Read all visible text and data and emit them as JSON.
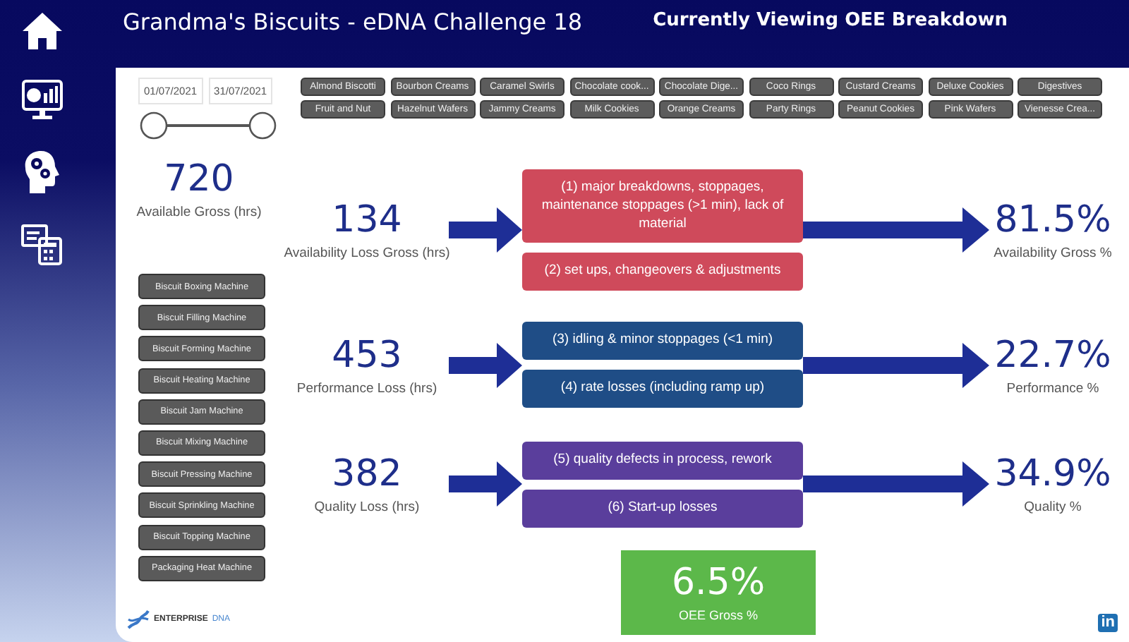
{
  "header": {
    "title": "Grandma's Biscuits - eDNA Challenge 18",
    "view_title": "Currently Viewing OEE Breakdown"
  },
  "date_range": {
    "start": "01/07/2021",
    "end": "31/07/2021",
    "handles": [
      {
        "level": 0
      },
      {
        "level": 1
      }
    ]
  },
  "product_chips": [
    {
      "label": "Almond Biscotti",
      "selected": false
    },
    {
      "label": "Bourbon Creams",
      "selected": false
    },
    {
      "label": "Caramel Swirls",
      "selected": false
    },
    {
      "label": "Chocolate cook...",
      "selected": false
    },
    {
      "label": "Chocolate Dige...",
      "selected": false
    },
    {
      "label": "Coco Rings",
      "selected": false
    },
    {
      "label": "Custard Creams",
      "selected": false
    },
    {
      "label": "Deluxe Cookies",
      "selected": false
    },
    {
      "label": "Digestives",
      "selected": false
    },
    {
      "label": "Fruit and Nut",
      "selected": false
    },
    {
      "label": "Hazelnut Wafers",
      "selected": false
    },
    {
      "label": "Jammy Creams",
      "selected": false
    },
    {
      "label": "Milk Cookies",
      "selected": false
    },
    {
      "label": "Orange Creams",
      "selected": false
    },
    {
      "label": "Party Rings",
      "selected": false
    },
    {
      "label": "Peanut Cookies",
      "selected": false
    },
    {
      "label": "Pink Wafers",
      "selected": false
    },
    {
      "label": "Vienesse Crea...",
      "selected": false
    }
  ],
  "available": {
    "value": "720",
    "label": "Available Gross (hrs)"
  },
  "machines": [
    {
      "label": "Biscuit Boxing Machine",
      "selected": false
    },
    {
      "label": "Biscuit Filling Machine",
      "selected": false
    },
    {
      "label": "Biscuit Forming Machine",
      "selected": false
    },
    {
      "label": "Biscuit Heating Machine",
      "selected": false
    },
    {
      "label": "Biscuit Jam Machine",
      "selected": false
    },
    {
      "label": "Biscuit Mixing Machine",
      "selected": false
    },
    {
      "label": "Biscuit Pressing Machine",
      "selected": false
    },
    {
      "label": "Biscuit Sprinkling Machine",
      "selected": false
    },
    {
      "label": "Biscuit Topping Machine",
      "selected": false
    },
    {
      "label": "Packaging Heat Machine",
      "selected": false
    }
  ],
  "sections": [
    {
      "value": "134",
      "label": "Availability Loss Gross (hrs)",
      "color": "#cf4a5b",
      "losses": [
        "(1) major breakdowns, stoppages, maintenance stoppages (>1 min), lack of material",
        "(2) set ups, changeovers & adjustments"
      ],
      "result": "81.5%",
      "result_label": "Availability Gross %"
    },
    {
      "value": "453",
      "label": "Performance Loss (hrs)",
      "color": "#1f4d86",
      "losses": [
        "(3) idling & minor stoppages (<1 min)",
        "(4) rate losses (including ramp up)"
      ],
      "result": "22.7%",
      "result_label": "Performance %"
    },
    {
      "value": "382",
      "label": "Quality Loss (hrs)",
      "color": "#5a3e9c",
      "losses": [
        "(5) quality defects in process, rework",
        "(6) Start-up losses"
      ],
      "result": "34.9%",
      "result_label": "Quality %"
    }
  ],
  "oee": {
    "value": "6.5%",
    "label": "OEE Gross %"
  },
  "logo": {
    "word_1": "ENTERPRISE",
    "word_2": "DNA"
  },
  "linkedin": {
    "text": "in"
  }
}
